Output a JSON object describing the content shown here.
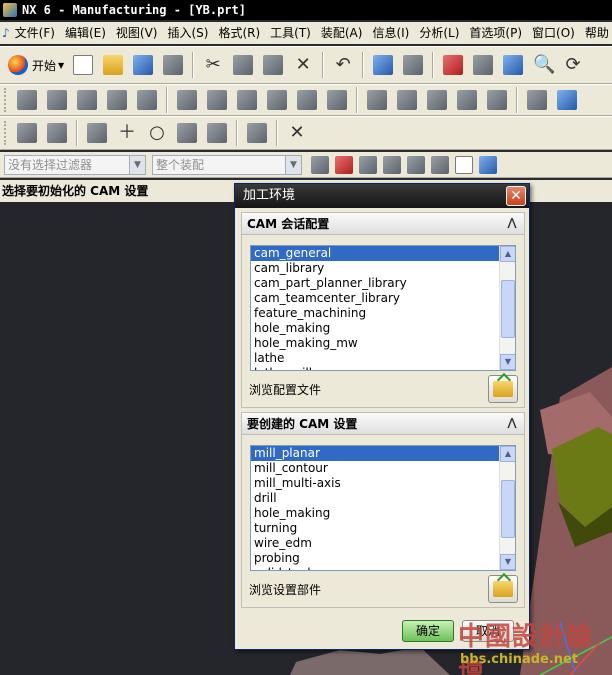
{
  "window": {
    "title": "NX 6 - Manufacturing - [YB.prt]"
  },
  "menubar": {
    "items": [
      "文件(F)",
      "编辑(E)",
      "视图(V)",
      "插入(S)",
      "格式(R)",
      "工具(T)",
      "装配(A)",
      "信息(I)",
      "分析(L)",
      "首选项(P)",
      "窗口(O)",
      "帮助"
    ]
  },
  "toolbar": {
    "start_label": "开始"
  },
  "filterbar": {
    "selection_filter": "没有选择过滤器",
    "assembly_scope": "整个装配"
  },
  "cue_line": {
    "text": "选择要初始化的 CAM 设置"
  },
  "dialog": {
    "title": "加工环境",
    "session_config": {
      "header": "CAM 会话配置",
      "items": [
        "cam_general",
        "cam_library",
        "cam_part_planner_library",
        "cam_teamcenter_library",
        "feature_machining",
        "hole_making",
        "hole_making_mw",
        "lathe",
        "lathe_mill"
      ],
      "selected": "cam_general",
      "browse_label": "浏览配置文件"
    },
    "cam_setup": {
      "header": "要创建的 CAM 设置",
      "items": [
        "mill_planar",
        "mill_contour",
        "mill_multi-axis",
        "drill",
        "hole_making",
        "turning",
        "wire_edm",
        "probing",
        "solid_tool"
      ],
      "selected": "mill_planar",
      "browse_label": "浏览设置部件"
    },
    "ok_label": "确定",
    "cancel_label": "取消"
  },
  "watermark": {
    "main": "中國設計論壇",
    "sub": "bbs.chinade.net"
  },
  "colors": {
    "chrome": "#ece9d8",
    "selection": "#316ac5",
    "dialog_title": "#1e1e1e",
    "ok_button": "#6fc25a",
    "graphics_bg": "#25262c"
  }
}
